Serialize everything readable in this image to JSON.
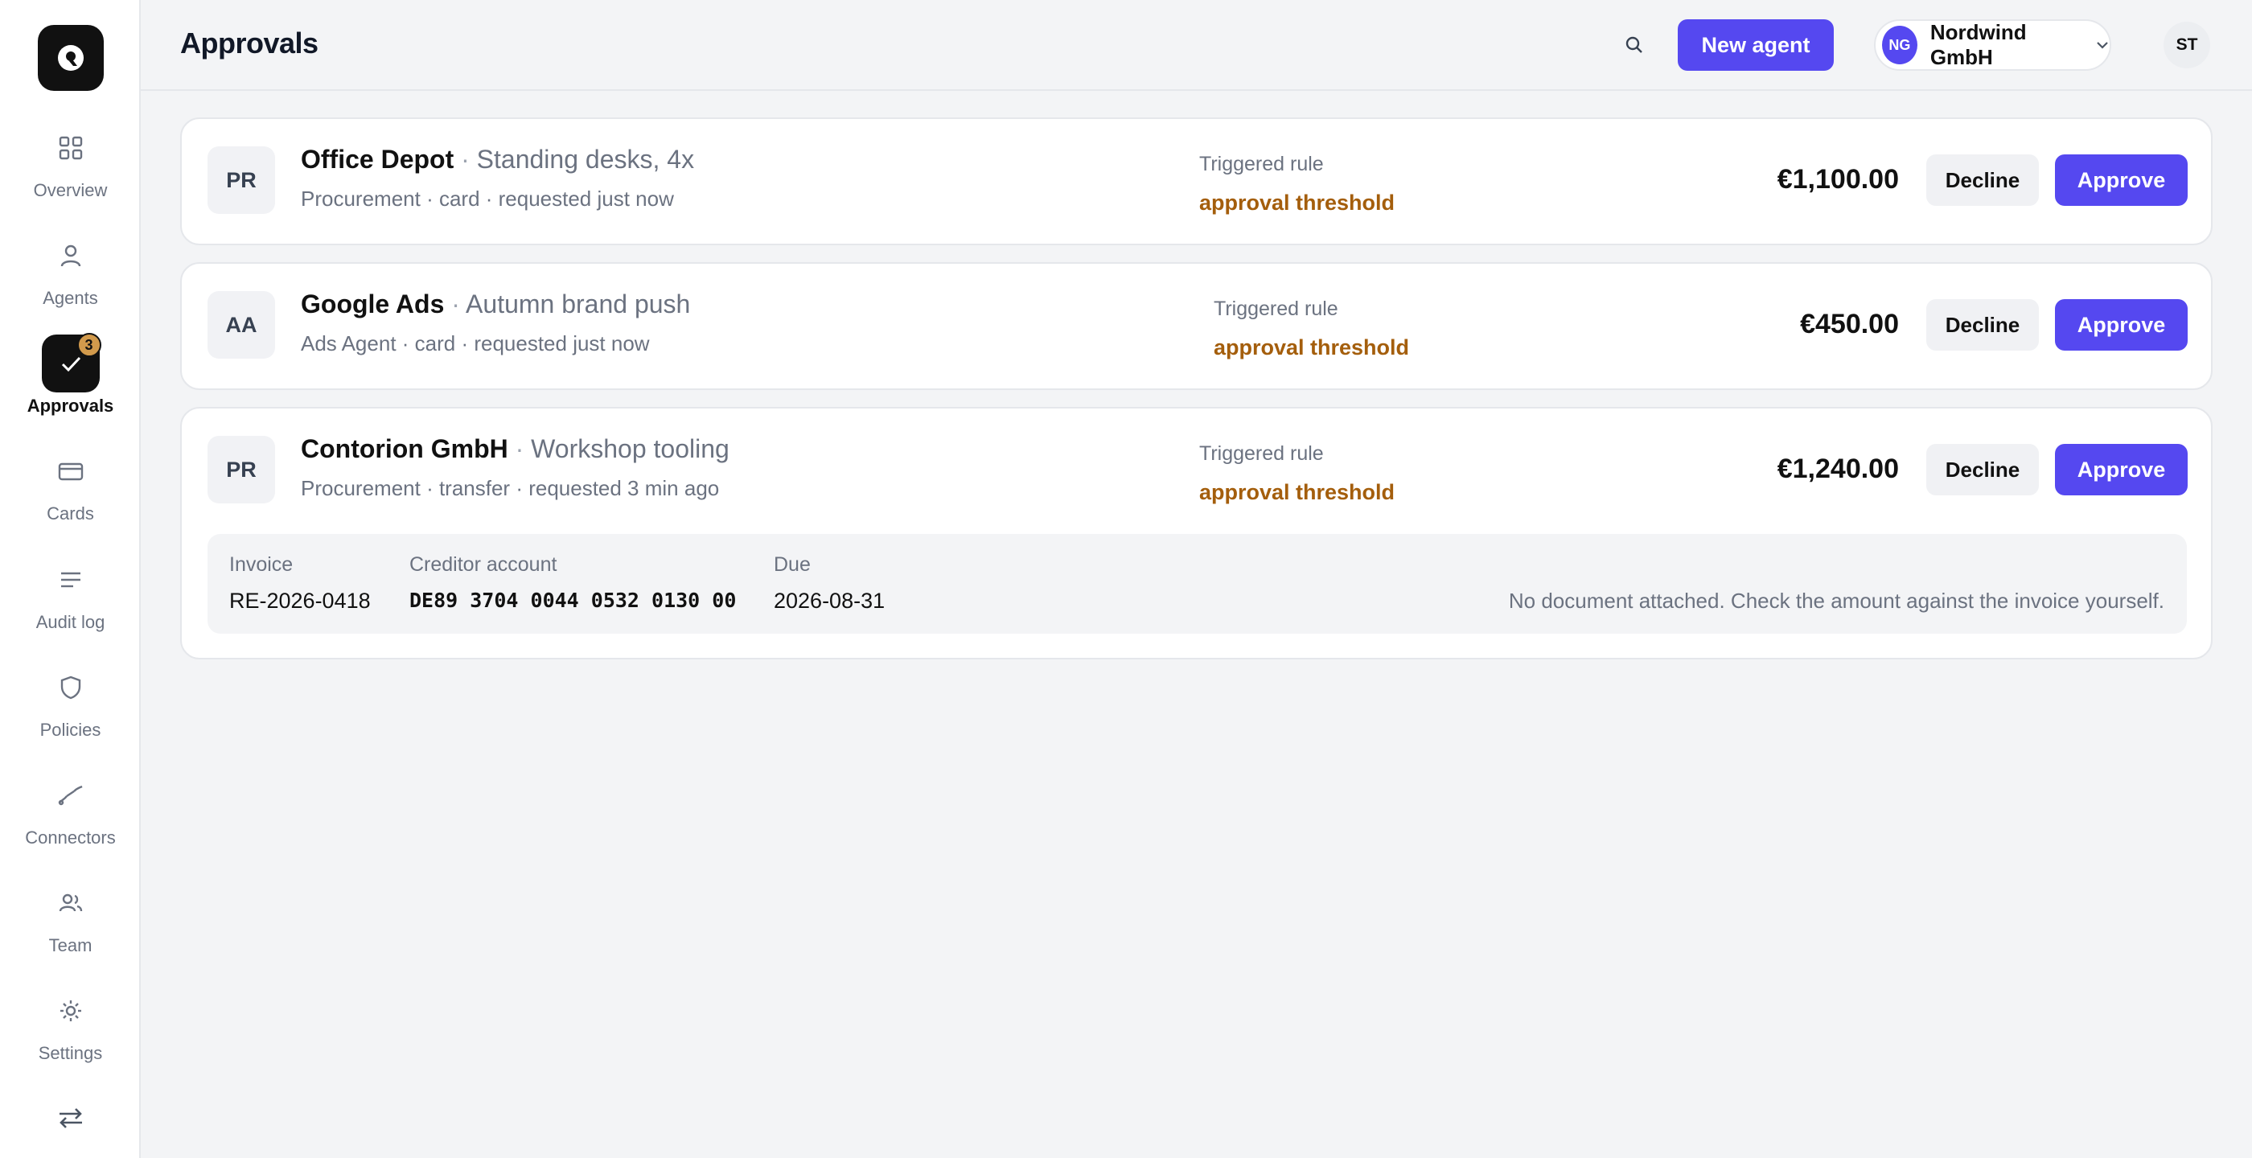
{
  "sidebar": {
    "logo_icon": "q-logo-icon",
    "items": [
      {
        "label": "Overview",
        "icon": "grid-icon"
      },
      {
        "label": "Agents",
        "icon": "user-icon"
      },
      {
        "label": "Approvals",
        "icon": "check-icon",
        "active": true,
        "badge": "3"
      },
      {
        "label": "Cards",
        "icon": "card-icon"
      },
      {
        "label": "Audit log",
        "icon": "lines-icon"
      },
      {
        "label": "Policies",
        "icon": "shield-icon"
      },
      {
        "label": "Connectors",
        "icon": "link-icon"
      },
      {
        "label": "Team",
        "icon": "team-icon"
      },
      {
        "label": "Settings",
        "icon": "gear-icon"
      }
    ],
    "bottom_icon": "swap-icon"
  },
  "header": {
    "title": "Approvals",
    "new_agent_label": "New agent",
    "org": {
      "initials": "NG",
      "name": "Nordwind GmbH"
    },
    "user_initials": "ST"
  },
  "colors": {
    "accent": "#5548f0",
    "rule_text": "#a45e0c",
    "badge": "#d29a4c"
  },
  "approvals": [
    {
      "initials": "PR",
      "merchant": "Office Depot",
      "separator": "·",
      "purpose": "Standing desks, 4x",
      "meta": "Procurement · card · requested just now",
      "rule_label": "Triggered rule",
      "rule": "approval threshold",
      "amount": "€1,100.00",
      "decline_label": "Decline",
      "approve_label": "Approve"
    },
    {
      "initials": "AA",
      "merchant": "Google Ads",
      "separator": "·",
      "purpose": "Autumn brand push",
      "meta": "Ads Agent · card · requested just now",
      "rule_label": "Triggered rule",
      "rule": "approval threshold",
      "amount": "€450.00",
      "decline_label": "Decline",
      "approve_label": "Approve"
    },
    {
      "initials": "PR",
      "merchant": "Contorion GmbH",
      "separator": "·",
      "purpose": "Workshop tooling",
      "meta": "Procurement · transfer · requested 3 min ago",
      "rule_label": "Triggered rule",
      "rule": "approval threshold",
      "amount": "€1,240.00",
      "decline_label": "Decline",
      "approve_label": "Approve",
      "details": {
        "invoice_label": "Invoice",
        "invoice": "RE-2026-0418",
        "creditor_label": "Creditor account",
        "creditor": "DE89 3704 0044 0532 0130 00",
        "due_label": "Due",
        "due": "2026-08-31",
        "note": "No document attached. Check the amount against the invoice yourself."
      }
    }
  ]
}
